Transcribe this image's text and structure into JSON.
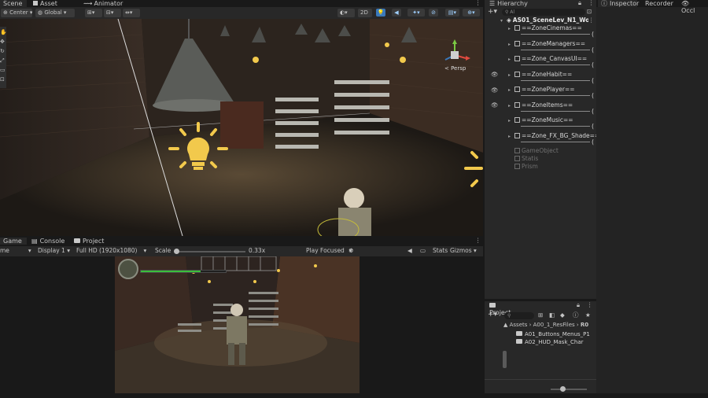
{
  "tabs": {
    "scene": "Scene",
    "asset_store": "Asset Store",
    "animator": "Animator",
    "hierarchy": "Hierarchy",
    "inspector": "Inspector",
    "recorder": "Recorder",
    "occlusion": "Occl"
  },
  "scene_toolbar": {
    "pivot": "Center",
    "space": "Global",
    "mode_2d": "2D",
    "persp": "< Persp"
  },
  "game_tabs": {
    "game": "Game",
    "console": "Console",
    "project": "Project"
  },
  "game_toolbar": {
    "mode": "me",
    "display": "Display 1",
    "resolution": "Full HD (1920x1080)",
    "scale_label": "Scale",
    "scale_value": "0.33x",
    "play_mode": "Play Focused",
    "stats": "Stats",
    "gizmos": "Gizmos"
  },
  "hierarchy": {
    "root": "AS01_SceneLev_N1_Wor",
    "items": [
      {
        "label": "==ZoneCinemas=="
      },
      {
        "label": "==ZoneManagers=="
      },
      {
        "label": "==Zone_CanvasUI=="
      },
      {
        "label": "==ZoneHabit=="
      },
      {
        "label": "==ZonePlayer=="
      },
      {
        "label": "==ZoneItems=="
      },
      {
        "label": "==ZoneMusic=="
      },
      {
        "label": "==Zone_FX_BG_Shade=="
      }
    ],
    "inactive": [
      "GameObject",
      "Statis",
      "Prism"
    ],
    "paren": "("
  },
  "project": {
    "title": "Project",
    "breadcrumb": [
      "Assets",
      "A00_1_ResFiles",
      "R0"
    ],
    "folders": [
      "A01_Buttons_Menus_P1",
      "A02_HUD_Mask_Char"
    ]
  },
  "game_view": {
    "health_fraction": 0.7
  },
  "colors": {
    "accent": "#3a79bb",
    "health": "#3bbf3b",
    "panel": "#282828",
    "background": "#191919"
  }
}
